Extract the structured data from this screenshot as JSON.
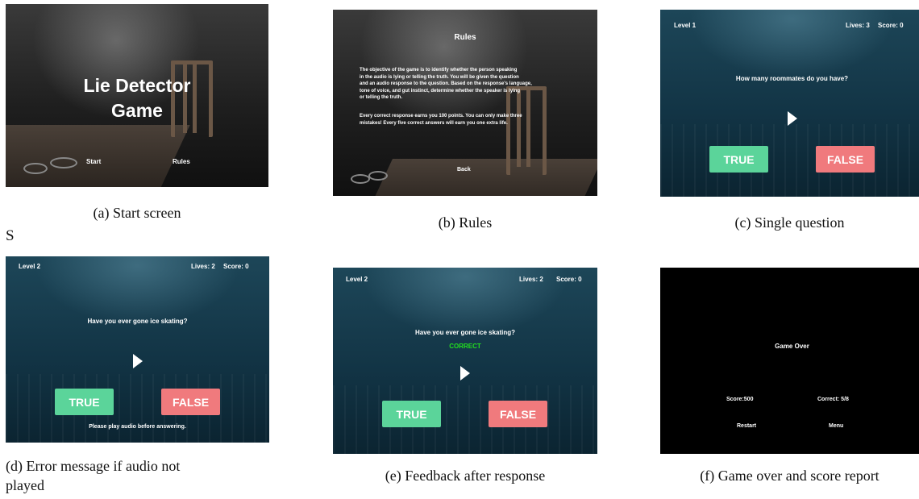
{
  "stray_letter": "S",
  "panels": {
    "start": {
      "title_line1": "Lie Detector",
      "title_line2": "Game",
      "start_label": "Start",
      "rules_label": "Rules",
      "caption": "(a) Start screen"
    },
    "rules": {
      "title": "Rules",
      "paragraph1_lines": [
        "The objective of the game is to identify whether the person speaking",
        "in the audio is lying or telling the truth. You will be given the question",
        "and an audio response to the question. Based on the response's language,",
        "tone of voice, and gut instinct, determine whether the speaker is lying",
        "or telling the truth."
      ],
      "paragraph2_lines": [
        "Every correct response earns you 100 points. You can only make three",
        "mistakes! Every five correct answers will earn you one extra life."
      ],
      "back_label": "Back",
      "caption": "(b) Rules"
    },
    "single_question": {
      "level": "Level 1",
      "lives": "Lives: 3",
      "score": "Score: 0",
      "question": "How many roommates do you have?",
      "true_label": "TRUE",
      "false_label": "FALSE",
      "caption": "(c) Single question"
    },
    "error": {
      "level": "Level 2",
      "lives": "Lives: 2",
      "score": "Score: 0",
      "question": "Have you ever gone ice skating?",
      "true_label": "TRUE",
      "false_label": "FALSE",
      "message": "Please play audio before answering.",
      "caption_line1": "(d) Error message if audio not",
      "caption_line2": "played"
    },
    "feedback": {
      "level": "Level 2",
      "lives": "Lives: 2",
      "score": "Score: 0",
      "question": "Have you ever gone ice skating?",
      "feedback": "CORRECT",
      "feedback_color": "#22e01f",
      "true_label": "TRUE",
      "false_label": "FALSE",
      "caption": "(e) Feedback after response"
    },
    "game_over": {
      "title": "Game Over",
      "score": "Score:500",
      "correct": "Correct: 5/8",
      "restart_label": "Restart",
      "menu_label": "Menu",
      "caption": "(f) Game over and score report"
    }
  },
  "colors": {
    "true_button": "#5bd49a",
    "false_button": "#f07a7d",
    "game_background": "#123445"
  },
  "icons": [
    "play-icon"
  ]
}
